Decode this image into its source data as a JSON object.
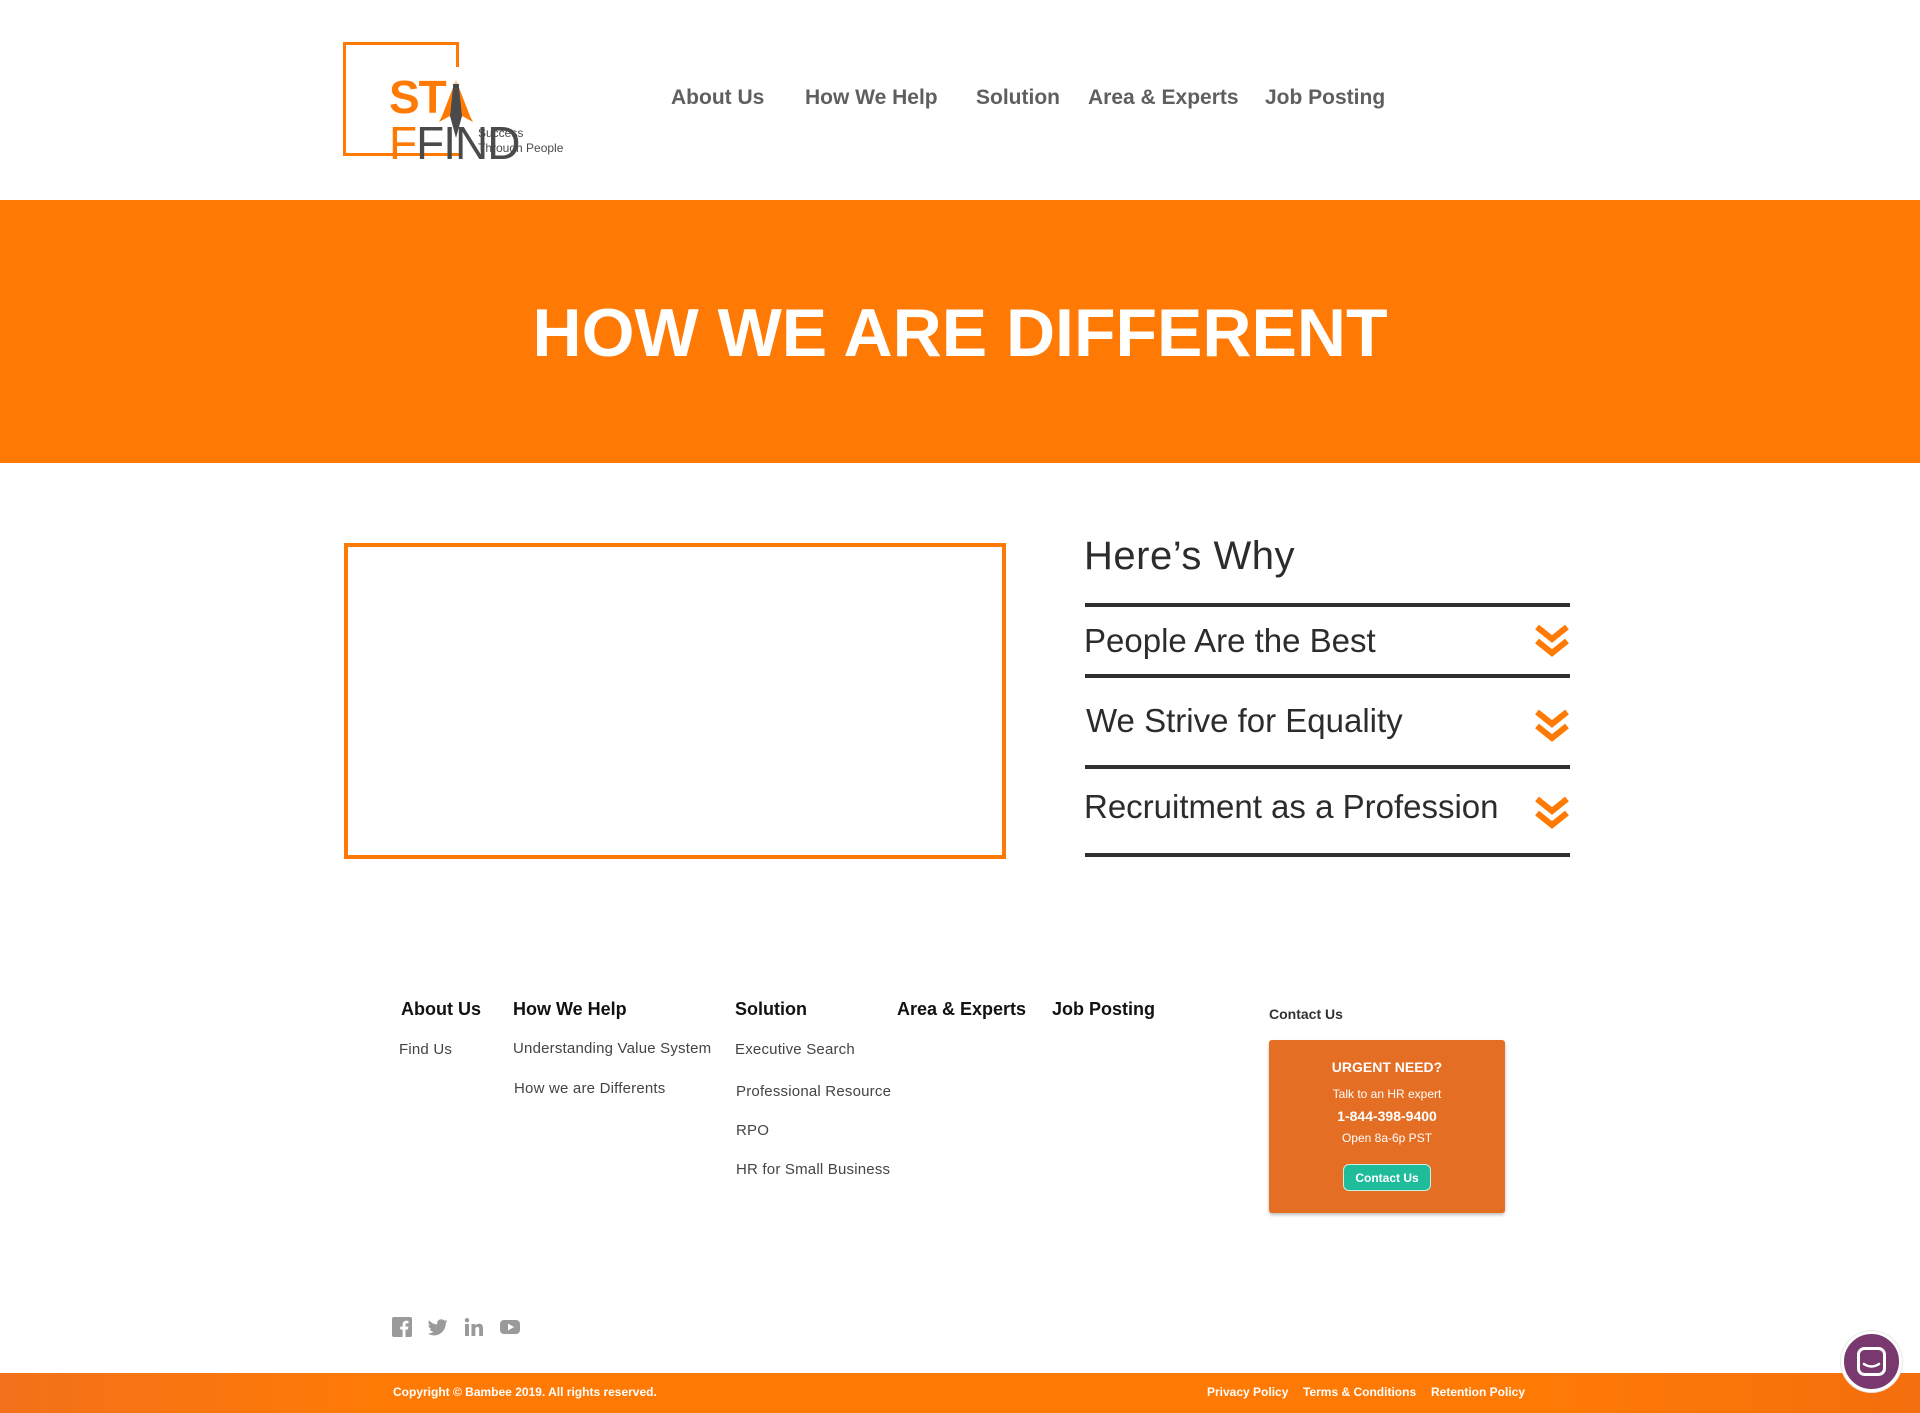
{
  "header": {
    "logo": {
      "brand": "STAFFIND",
      "tagline": "Success\nThrough People"
    },
    "nav": [
      "About Us",
      "How We Help",
      "Solution",
      "Area & Experts",
      "Job Posting"
    ]
  },
  "banner": {
    "title": "HOW WE ARE DIFFERENT"
  },
  "why": {
    "title": "Here’s Why",
    "items": [
      "People Are the Best",
      "We Strive for Equality",
      "Recruitment as a Profession"
    ]
  },
  "footer": {
    "columns": [
      {
        "heading": "About Us",
        "links": [
          "Find  Us"
        ]
      },
      {
        "heading": "How We Help",
        "links": [
          "Understanding Value System",
          "How we are Differents"
        ]
      },
      {
        "heading": "Solution",
        "links": [
          "Executive Search",
          "Professional Resource",
          "RPO",
          "HR for Small Business"
        ]
      },
      {
        "heading": "Area & Experts",
        "links": []
      },
      {
        "heading": "Job Posting",
        "links": []
      }
    ],
    "contact": {
      "heading": "Contact Us",
      "urgent_title": "URGENT NEED?",
      "talk": "Talk to an HR expert",
      "phone": "1-844-398-9400",
      "hours": "Open 8a-6p PST",
      "button": "Contact Us"
    },
    "social": [
      "facebook-icon",
      "twitter-icon",
      "linkedin-icon",
      "youtube-icon"
    ],
    "copyright": "Copyright © Bambee 2019. All rights reserved.",
    "legal": [
      "Privacy Policy",
      "Terms & Conditions",
      "Retention Policy"
    ]
  },
  "colors": {
    "accent": "#ff7a05",
    "dark": "#2f2f2f",
    "urgent_bg": "#e46e24",
    "button_teal": "#1fbc9c",
    "chat": "#79396e"
  }
}
